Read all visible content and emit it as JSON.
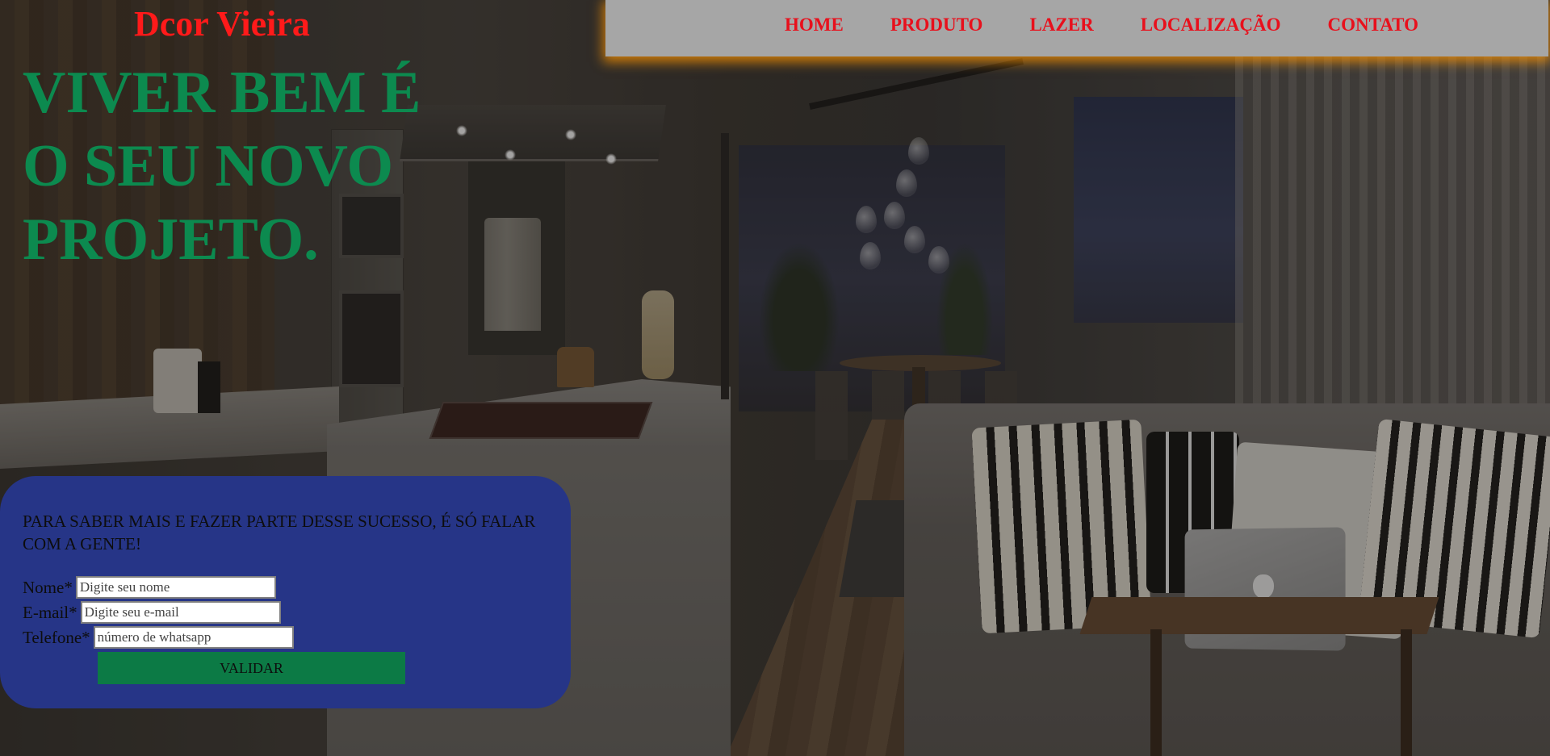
{
  "header": {
    "brand": "Dcor Vieira"
  },
  "nav": {
    "items": [
      {
        "label": "HOME"
      },
      {
        "label": "PRODUTO"
      },
      {
        "label": "LAZER"
      },
      {
        "label": "LOCALIZAÇÃO"
      },
      {
        "label": "CONTATO"
      }
    ]
  },
  "hero": {
    "title_lines": [
      "VIVER BEM É",
      "O SEU NOVO",
      "PROJETO."
    ]
  },
  "contact": {
    "intro": "PARA SABER MAIS E FAZER PARTE DESSE SUCESSO, É SÓ FALAR COM A GENTE!",
    "fields": [
      {
        "label": "Nome*",
        "placeholder": "Digite seu nome",
        "value": ""
      },
      {
        "label": "E-mail*",
        "placeholder": "Digite seu e-mail",
        "value": ""
      },
      {
        "label": "Telefone*",
        "placeholder": "número de whatsapp",
        "value": ""
      }
    ],
    "submit_label": "VALIDAR"
  },
  "colors": {
    "brand": "#ff1a1a",
    "nav_background": "#a6a6a6",
    "nav_link": "#e8101c",
    "nav_glow": "#ff9600",
    "hero_title": "#0c8a4f",
    "form_panel": "#263587",
    "submit_button": "#0c7a45"
  },
  "background": {
    "icon": "living-room-interior-photo"
  }
}
